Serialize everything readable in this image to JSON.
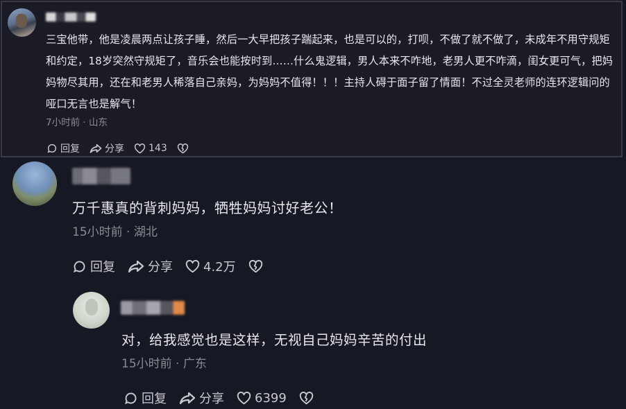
{
  "comments": [
    {
      "text": "三宝他带，他是凌晨两点让孩子睡，然后一大早把孩子踹起来，也是可以的，打呗，不做了就不做了，未成年不用守规矩和约定，18岁突然守规矩了，音乐会也能按时到……什么鬼逻辑，男人本来不咋地，老男人更不咋滴，闺女更可气，把妈妈物尽其用，还在和老男人稀落自己亲妈，为妈妈不值得！！！主持人碍于面子留了情面！不过全灵老师的连环逻辑问的哑口无言也是解气！",
      "meta": "7小时前 · 山东",
      "reply_label": "回复",
      "share_label": "分享",
      "likes": "143",
      "icons": [
        "reply-icon",
        "share-icon",
        "heart-icon",
        "broken-heart-icon"
      ]
    },
    {
      "text": "万千惠真的背刺妈妈，牺牲妈妈讨好老公！",
      "meta": "15小时前 · 湖北",
      "reply_label": "回复",
      "share_label": "分享",
      "likes": "4.2万",
      "icons": [
        "reply-icon",
        "share-icon",
        "heart-icon",
        "broken-heart-icon"
      ]
    },
    {
      "text": "对，给我感觉也是这样，无视自己妈妈辛苦的付出",
      "meta": "15小时前 · 广东",
      "reply_label": "回复",
      "share_label": "分享",
      "likes": "6399",
      "icons": [
        "reply-icon",
        "share-icon",
        "heart-icon",
        "broken-heart-icon"
      ]
    }
  ],
  "colors": {
    "background": "#161823",
    "text": "#e8e8ec",
    "meta": "#8a8b93",
    "action": "#c8c9cf",
    "highlight_border": "#3a3b44"
  }
}
